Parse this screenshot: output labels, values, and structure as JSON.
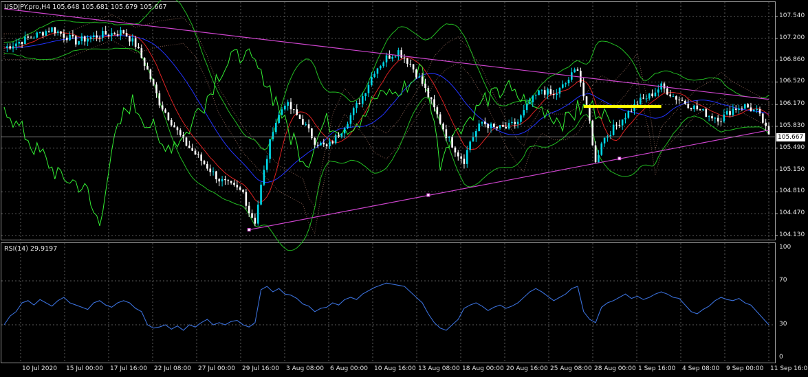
{
  "window": {
    "symbol_header": "USDJPY.pro,H4  105.648 105.681 105.679 105.667",
    "rsi_header": "RSI(14) 29.9197",
    "current_price_label": "105.667"
  },
  "colors": {
    "background": "#000000",
    "grid": "#5a5a5a",
    "bull_candle": "#00d8e8",
    "bear_candle": "#ffffff",
    "trendline": "#cc44cc",
    "bollinger": "#22bb22",
    "chikou": "#33ee33",
    "tenkan": "#dd2222",
    "kijun": "#2233ff",
    "rsi_line": "#3a6fd8",
    "highlight_segment": "#ffff00"
  },
  "chart_data": [
    {
      "type": "candlestick",
      "title": "USDJPY.pro,H4",
      "ylim": [
        104.13,
        107.7
      ],
      "y_ticks": [
        "107.540",
        "107.200",
        "106.860",
        "106.520",
        "106.170",
        "105.830",
        "105.490",
        "105.150",
        "104.810",
        "104.470",
        "104.130"
      ],
      "x_ticks": [
        "10 Jul 2020",
        "15 Jul 00:00",
        "17 Jul 16:00",
        "22 Jul 08:00",
        "27 Jul 00:00",
        "29 Jul 16:00",
        "3 Aug 08:00",
        "6 Aug 00:00",
        "10 Aug 16:00",
        "13 Aug 08:00",
        "18 Aug 00:00",
        "20 Aug 16:00",
        "25 Aug 08:00",
        "28 Aug 00:00",
        "1 Sep 16:00",
        "4 Sep 08:00",
        "9 Sep 00:00",
        "11 Sep 16:00"
      ],
      "last_price": 105.667,
      "close_path": [
        [
          0,
          107.05
        ],
        [
          4,
          107.2
        ],
        [
          8,
          107.35
        ],
        [
          12,
          107.15
        ],
        [
          16,
          107.25
        ],
        [
          20,
          107.3
        ],
        [
          22,
          107.1
        ],
        [
          24,
          106.7
        ],
        [
          26,
          106.2
        ],
        [
          28,
          105.9
        ],
        [
          30,
          105.6
        ],
        [
          32,
          105.4
        ],
        [
          34,
          105.2
        ],
        [
          36,
          105.0
        ],
        [
          38,
          104.9
        ],
        [
          40,
          104.8
        ],
        [
          41,
          104.5
        ],
        [
          42,
          104.35
        ],
        [
          43,
          104.9
        ],
        [
          45,
          105.8
        ],
        [
          47,
          106.2
        ],
        [
          48,
          106.1
        ],
        [
          50,
          105.9
        ],
        [
          52,
          105.6
        ],
        [
          54,
          105.5
        ],
        [
          56,
          105.7
        ],
        [
          58,
          106.0
        ],
        [
          60,
          106.3
        ],
        [
          62,
          106.7
        ],
        [
          64,
          106.9
        ],
        [
          66,
          107.0
        ],
        [
          68,
          106.8
        ],
        [
          70,
          106.5
        ],
        [
          72,
          106.1
        ],
        [
          74,
          105.7
        ],
        [
          76,
          105.4
        ],
        [
          77,
          105.3
        ],
        [
          78,
          105.6
        ],
        [
          80,
          105.9
        ],
        [
          82,
          105.8
        ],
        [
          84,
          105.8
        ],
        [
          86,
          105.9
        ],
        [
          88,
          106.2
        ],
        [
          90,
          106.4
        ],
        [
          92,
          106.3
        ],
        [
          94,
          106.5
        ],
        [
          96,
          106.75
        ],
        [
          97,
          106.3
        ],
        [
          98,
          105.9
        ],
        [
          99,
          105.25
        ],
        [
          100,
          105.6
        ],
        [
          102,
          105.8
        ],
        [
          104,
          106.0
        ],
        [
          106,
          106.2
        ],
        [
          108,
          106.3
        ],
        [
          110,
          106.45
        ],
        [
          112,
          106.3
        ],
        [
          114,
          106.2
        ],
        [
          116,
          106.1
        ],
        [
          118,
          106.0
        ],
        [
          120,
          105.95
        ],
        [
          122,
          106.1
        ],
        [
          124,
          106.15
        ],
        [
          126,
          106.05
        ],
        [
          127,
          105.9
        ],
        [
          128,
          105.667
        ]
      ],
      "trendlines": [
        {
          "from": [
            0,
            107.66
          ],
          "to": [
            128,
            106.25
          ]
        },
        {
          "from": [
            41,
            104.22
          ],
          "to": [
            128,
            105.77
          ]
        }
      ],
      "trendline_markers": [
        [
          41,
          104.22
        ],
        [
          71,
          104.76
        ],
        [
          103,
          105.33
        ]
      ],
      "highlight_segment": {
        "from": [
          97,
          106.14
        ],
        "to": [
          110,
          106.14
        ]
      }
    },
    {
      "type": "line",
      "title": "RSI(14)",
      "ylim": [
        0,
        100
      ],
      "y_ticks": [
        "100",
        "70",
        "30",
        "0"
      ],
      "y_tick_values": [
        100,
        70,
        30,
        0
      ],
      "values": [
        30,
        38,
        42,
        50,
        52,
        48,
        53,
        50,
        47,
        52,
        55,
        50,
        48,
        46,
        44,
        50,
        52,
        48,
        46,
        50,
        52,
        50,
        45,
        42,
        30,
        27,
        28,
        30,
        26,
        29,
        25,
        30,
        28,
        32,
        35,
        30,
        32,
        30,
        33,
        34,
        30,
        28,
        32,
        62,
        65,
        60,
        63,
        58,
        57,
        54,
        49,
        47,
        42,
        45,
        46,
        50,
        48,
        53,
        55,
        53,
        58,
        61,
        64,
        66,
        68,
        67,
        66,
        65,
        60,
        55,
        50,
        40,
        32,
        27,
        25,
        30,
        35,
        45,
        48,
        50,
        47,
        43,
        46,
        48,
        45,
        47,
        50,
        55,
        60,
        63,
        60,
        56,
        52,
        55,
        58,
        63,
        65,
        42,
        35,
        32,
        46,
        50,
        52,
        55,
        58,
        54,
        56,
        53,
        55,
        58,
        60,
        58,
        55,
        54,
        48,
        42,
        40,
        44,
        47,
        52,
        55,
        53,
        52,
        54,
        50,
        48,
        42,
        36,
        30
      ]
    }
  ]
}
